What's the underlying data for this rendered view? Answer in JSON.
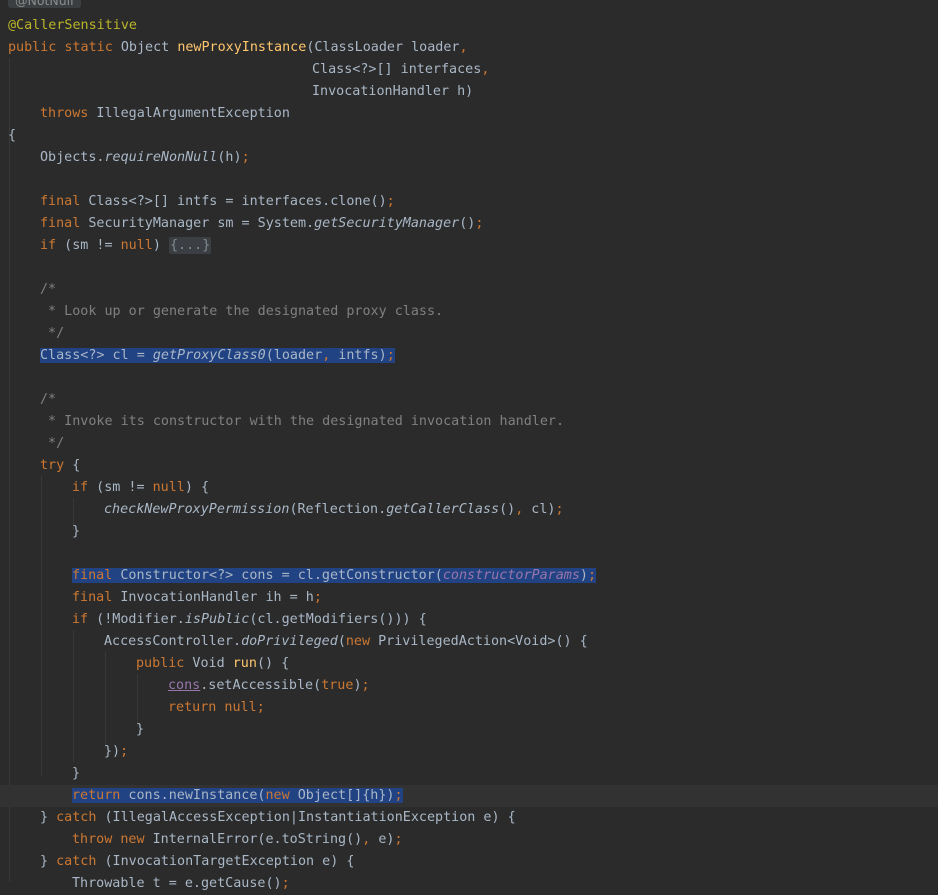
{
  "editor": {
    "inlay_hint": "@NotNull",
    "l01": {
      "ann": "@CallerSensitive"
    },
    "l02": {
      "kw": "public static",
      "t1": " Object ",
      "fn": "newProxyInstance",
      "t2": "(ClassLoader loader",
      "c": ","
    },
    "l03": {
      "t1": "Class<?>[] interfaces",
      "c": ","
    },
    "l04": {
      "t1": "InvocationHandler h)"
    },
    "l05": {
      "kw": "throws",
      "t1": " IllegalArgumentException"
    },
    "l06": {
      "t1": "{"
    },
    "l07": {
      "t1": "Objects.",
      "st": "requireNonNull",
      "t2": "(h)",
      "c": ";"
    },
    "l08": {
      "kw": "final",
      "t1": " Class<?>[] intfs = interfaces.clone()",
      "c": ";"
    },
    "l09": {
      "kw": "final",
      "t1": " SecurityManager sm = System.",
      "st": "getSecurityManager",
      "t2": "()",
      "c": ";"
    },
    "l10": {
      "kw1": "if",
      "t1": " (sm != ",
      "kw2": "null",
      "t2": ") ",
      "fold": "{...}"
    },
    "l11": {
      "cm": "/*"
    },
    "l12": {
      "cm": " * Look up or generate the designated proxy class."
    },
    "l13": {
      "cm": " */"
    },
    "l14": {
      "t1": "Class<?> cl = ",
      "st": "getProxyClass0",
      "t2": "(loader",
      "c": ",",
      "t3": " intfs)",
      "c2": ";"
    },
    "l15": {
      "cm": "/*"
    },
    "l16": {
      "cm": " * Invoke its constructor with the designated invocation handler."
    },
    "l17": {
      "cm": " */"
    },
    "l18": {
      "kw": "try",
      "t1": " {"
    },
    "l19": {
      "kw1": "if",
      "t1": " (sm != ",
      "kw2": "null",
      "t2": ") {"
    },
    "l20": {
      "st": "checkNewProxyPermission",
      "t1": "(Reflection.",
      "st2": "getCallerClass",
      "t2": "()",
      "c": ",",
      "t3": " cl)",
      "c2": ";"
    },
    "l21": {
      "t1": "}"
    },
    "l22": {
      "kw": "final",
      "t1": " Constructor<?> cons = cl.getConstructor(",
      "pm": "constructorParams",
      "t2": ")",
      "c": ";"
    },
    "l23": {
      "kw": "final",
      "t1": " InvocationHandler ih = h",
      "c": ";"
    },
    "l24": {
      "kw": "if",
      "t1": " (!Modifier.",
      "st": "isPublic",
      "t2": "(cl.getModifiers())) {"
    },
    "l25": {
      "t1": "AccessController.",
      "st": "doPrivileged",
      "t2": "(",
      "kw": "new",
      "t3": " PrivilegedAction<Void>() {"
    },
    "l26": {
      "kw": "public",
      "t1": " Void ",
      "fn": "run",
      "t2": "() {"
    },
    "l27": {
      "u": "cons",
      "t1": ".setAccessible(",
      "kw": "true",
      "t2": ")",
      "c": ";"
    },
    "l28": {
      "kw": "return null",
      "c": ";"
    },
    "l29": {
      "t1": "}"
    },
    "l30": {
      "t1": "})",
      "c": ";"
    },
    "l31": {
      "t1": "}"
    },
    "l32": {
      "kw1": "return",
      "t1": " cons.newInstance(",
      "kw2": "new",
      "t2": " Object[]{h})",
      "c": ";"
    },
    "l33": {
      "t1": "} ",
      "kw": "catch",
      "t2": " (IllegalAccessException|InstantiationException e) {"
    },
    "l34": {
      "kw": "throw new",
      "t1": " InternalError(e.toString()",
      "c": ",",
      "t2": " e)",
      "c2": ";"
    },
    "l35": {
      "t1": "} ",
      "kw": "catch",
      "t2": " (InvocationTargetException e) {"
    },
    "l36": {
      "t1": "Throwable t = e.getCause()",
      "c": ";"
    }
  }
}
